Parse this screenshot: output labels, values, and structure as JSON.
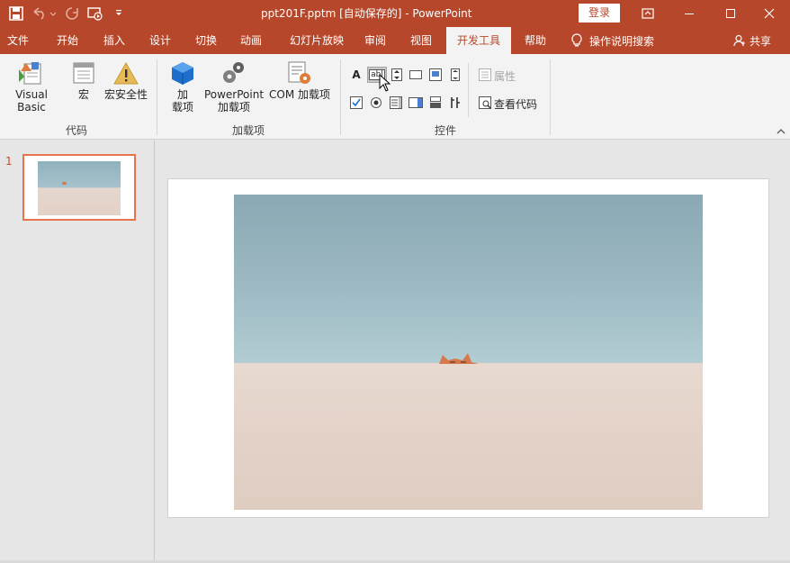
{
  "window": {
    "title": "ppt201F.pptm [自动保存的]  -  PowerPoint",
    "login_label": "登录"
  },
  "tabs": [
    "文件",
    "开始",
    "插入",
    "设计",
    "切换",
    "动画",
    "幻灯片放映",
    "审阅",
    "视图",
    "开发工具",
    "帮助"
  ],
  "active_tab": "开发工具",
  "tell_me": "操作说明搜索",
  "share": "共享",
  "ribbon": {
    "code_group": {
      "label": "代码",
      "visual_basic": "Visual Basic",
      "macros": "宏",
      "macro_security": "宏安全性"
    },
    "addins_group": {
      "label": "加载项",
      "addins_line1": "加",
      "addins_line2": "载项",
      "ppt_addins_line1": "PowerPoint",
      "ppt_addins_line2": "加载项",
      "com_addins": "COM 加载项"
    },
    "controls_group": {
      "label": "控件",
      "label_control": "A",
      "textbox_control": "abl",
      "properties": "属性",
      "view_code": "查看代码"
    }
  },
  "thumbnails": {
    "slide_number": "1"
  },
  "colors": {
    "accent": "#b7472a",
    "selection": "#e8734e"
  }
}
